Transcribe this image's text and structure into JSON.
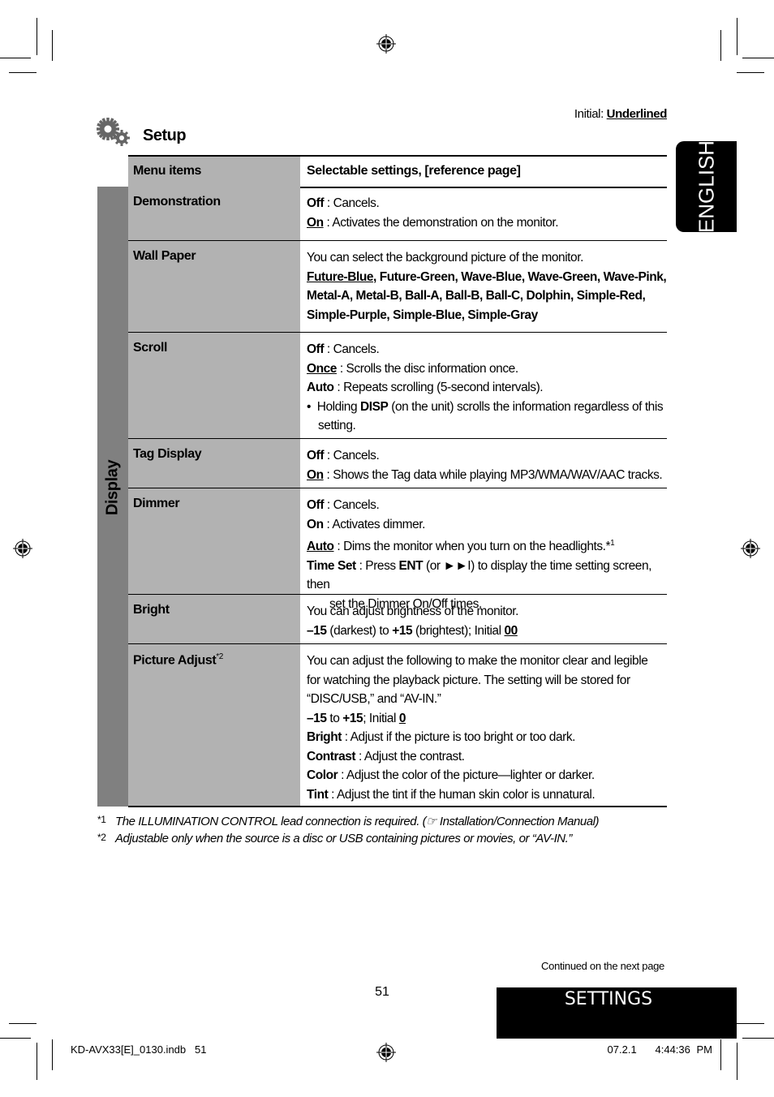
{
  "header": {
    "initial_label": "Initial:",
    "initial_value": "Underlined",
    "section_title": "Setup",
    "section_icon": "gears-icon",
    "language_tab": "ENGLISH"
  },
  "table": {
    "columns": [
      "Menu items",
      "Selectable settings, [reference page]"
    ],
    "group_label": "Display",
    "rows": [
      {
        "name": "Demonstration"
      },
      {
        "name": "Wall Paper"
      },
      {
        "name": "Scroll"
      },
      {
        "name": "Tag Display"
      },
      {
        "name": "Dimmer"
      },
      {
        "name": "Bright"
      },
      {
        "name": "Picture Adjust",
        "footnote_ref": "*2"
      }
    ],
    "demonstration": {
      "off_label": "Off",
      "off_text": " : Cancels.",
      "on_label": "On",
      "on_text": " : Activates the demonstration on the monitor."
    },
    "wallpaper": {
      "intro": "You can select the background picture of the monitor.",
      "default_option": "Future-Blue",
      "options_rest": ", Future-Green, Wave-Blue, Wave-Green, Wave-Pink, Metal-A, Metal-B, Ball-A, Ball-B, Ball-C, Dolphin, Simple-Red, Simple-Purple, Simple-Blue, Simple-Gray"
    },
    "scroll": {
      "off_label": "Off",
      "off_text": " : Cancels.",
      "once_label": "Once",
      "once_text": " : Scrolls the disc information once.",
      "auto_label": "Auto",
      "auto_text": " : Repeats scrolling (5-second intervals).",
      "note_pre": "Holding ",
      "note_key": "DISP",
      "note_post": " (on the unit) scrolls the information regardless of this setting."
    },
    "tag_display": {
      "off_label": "Off",
      "off_text": " : Cancels.",
      "on_label": "On",
      "on_text": " : Shows the Tag data while playing MP3/WMA/WAV/AAC tracks."
    },
    "dimmer": {
      "off_label": "Off",
      "off_text": " : Cancels.",
      "on_label": "On",
      "on_text": " : Activates dimmer.",
      "auto_label": "Auto",
      "auto_text": " : Dims the monitor when you turn on the headlights.*",
      "auto_ref": "1",
      "timeset_label": "Time Set",
      "timeset_pre": " : Press ",
      "timeset_key": "ENT",
      "timeset_mid": " (or ►►I) to display the time setting screen, then",
      "timeset_cont": "set the Dimmer On/Off times."
    },
    "bright": {
      "intro": "You can adjust brightness of the monitor.",
      "min": "–15",
      "min_text": " (darkest) to ",
      "max": "+15",
      "max_text": " (brightest); Initial ",
      "initial": "00"
    },
    "picture_adjust": {
      "intro": "You can adjust the following to make the monitor clear and legible for watching the playback picture. The setting will be stored for “DISC/USB,” and “AV-IN.”",
      "min": "–15",
      "range_text": " to ",
      "max": "+15",
      "initial_text": "; Initial ",
      "initial": "0",
      "items": [
        {
          "label": "Bright",
          "text": " : Adjust if the picture is too bright or too dark."
        },
        {
          "label": "Contrast",
          "text": " : Adjust the contrast."
        },
        {
          "label": "Color",
          "text": " : Adjust the color of the picture—lighter or darker."
        },
        {
          "label": "Tint",
          "text": " : Adjust the tint if the human skin color is unnatural."
        }
      ]
    }
  },
  "footnotes": [
    {
      "mark": "*1",
      "text": "The ILLUMINATION CONTROL lead connection is required. (☞ Installation/Connection Manual)"
    },
    {
      "mark": "*2",
      "text": "Adjustable only when the source is a disc or USB containing pictures or movies, or “AV-IN.”"
    }
  ],
  "footer": {
    "continued": "Continued on the next page",
    "page_number": "51",
    "section_tab": "SETTINGS",
    "file_slug": "KD-AVX33[E]_0130.indb   51",
    "timestamp": "07.2.1   4:44:36 PM"
  }
}
